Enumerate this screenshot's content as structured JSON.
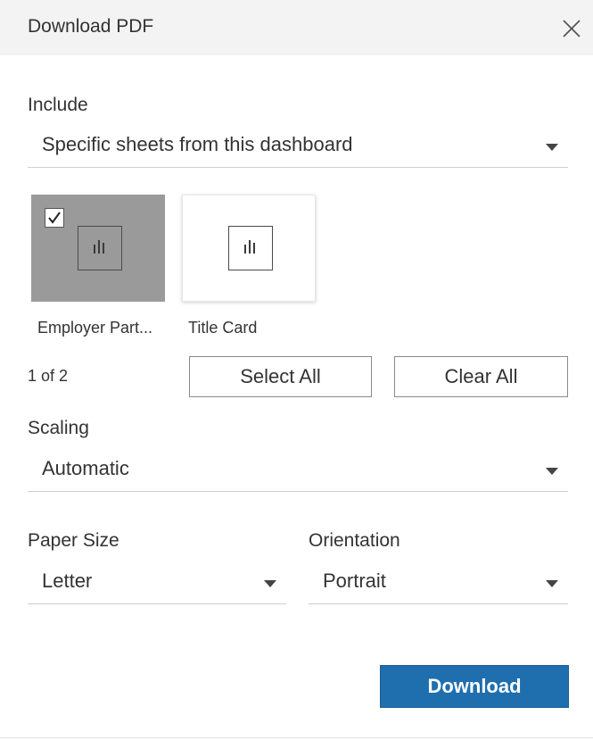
{
  "dialog": {
    "title": "Download PDF"
  },
  "include": {
    "label": "Include",
    "selected": "Specific sheets from this dashboard"
  },
  "sheets": {
    "items": [
      {
        "label": "Employer Part...",
        "selected": true,
        "icon": "bar-chart-icon"
      },
      {
        "label": "Title Card",
        "selected": false,
        "icon": "bar-chart-icon"
      }
    ],
    "count": "1 of 2",
    "select_all_label": "Select All",
    "clear_all_label": "Clear All"
  },
  "scaling": {
    "label": "Scaling",
    "selected": "Automatic"
  },
  "paper_size": {
    "label": "Paper Size",
    "selected": "Letter"
  },
  "orientation": {
    "label": "Orientation",
    "selected": "Portrait"
  },
  "actions": {
    "download_label": "Download"
  },
  "colors": {
    "primary": "#1f6fae",
    "header_bg": "#f3f3f3",
    "thumb_selected_bg": "#9a9a9a"
  }
}
